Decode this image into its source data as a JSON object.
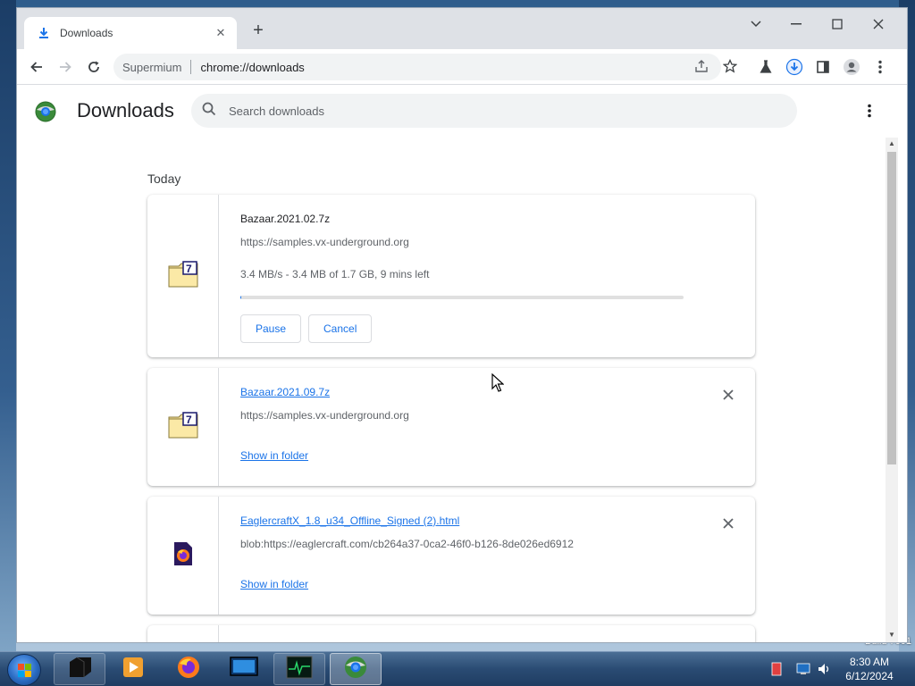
{
  "desktop": {
    "build_text": "Build 7601"
  },
  "tab": {
    "title": "Downloads"
  },
  "omnibox": {
    "origin": "Supermium",
    "url": "chrome://downloads"
  },
  "page": {
    "title": "Downloads",
    "search_placeholder": "Search downloads",
    "section_label": "Today"
  },
  "downloads": [
    {
      "name": "Bazaar.2021.02.7z",
      "url": "https://samples.vx-underground.org",
      "status": "3.4 MB/s - 3.4 MB of 1.7 GB, 9 mins left",
      "progress": 0.002,
      "pause_label": "Pause",
      "cancel_label": "Cancel"
    },
    {
      "name": "Bazaar.2021.09.7z",
      "url": "https://samples.vx-underground.org",
      "action_label": "Show in folder"
    },
    {
      "name": "EaglercraftX_1.8_u34_Offline_Signed (2).html",
      "url": "blob:https://eaglercraft.com/cb264a37-0ca2-46f0-b126-8de026ed6912",
      "action_label": "Show in folder"
    }
  ],
  "taskbar": {
    "time": "8:30 AM",
    "date": "6/12/2024"
  },
  "colors": {
    "accent": "#1a73e8",
    "progress_track": "#e0e0e0"
  }
}
